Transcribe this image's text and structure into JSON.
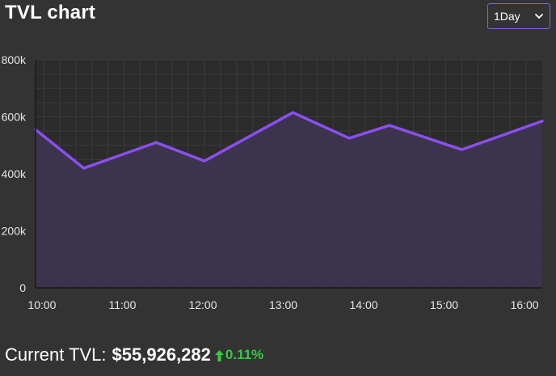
{
  "header": {
    "title": "TVL chart",
    "range_select": "1Day"
  },
  "colors": {
    "background": "#333333",
    "plot_background": "#2b2b2b",
    "accent": "#8a4ff0",
    "fill": "#3e3450",
    "positive": "#37c947"
  },
  "chart_data": {
    "type": "area",
    "title": "",
    "xlabel": "",
    "ylabel": "",
    "x": [
      "09:54",
      "10:30",
      "11:24",
      "12:00",
      "13:06",
      "13:48",
      "14:18",
      "15:12",
      "16:12"
    ],
    "values": [
      555000,
      420000,
      510000,
      445000,
      615000,
      525000,
      570000,
      485000,
      585000
    ],
    "ylim": [
      0,
      800000
    ],
    "yticks": [
      "0",
      "200k",
      "400k",
      "600k",
      "800k"
    ],
    "xticks": [
      "10:00",
      "11:00",
      "12:00",
      "13:00",
      "14:00",
      "15:00",
      "16:00"
    ],
    "grid": true,
    "legend": "none"
  },
  "footer": {
    "label": "Current TVL:",
    "value": "$55,926,282",
    "change": "0.11%",
    "change_direction": "up"
  }
}
